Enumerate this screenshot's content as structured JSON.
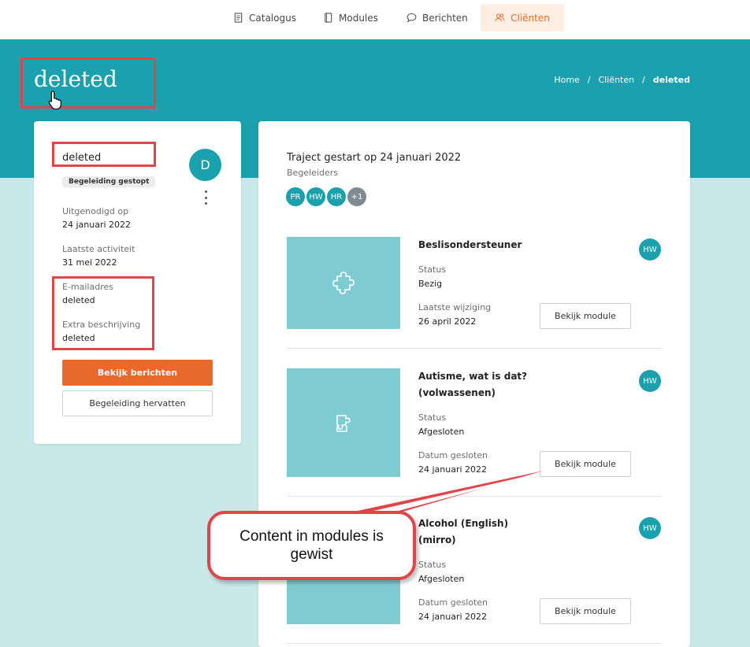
{
  "nav": {
    "items": [
      {
        "label": "Catalogus",
        "icon": "document-icon"
      },
      {
        "label": "Modules",
        "icon": "book-icon"
      },
      {
        "label": "Berichten",
        "icon": "chat-bubble-icon"
      },
      {
        "label": "Cliënten",
        "icon": "users-icon",
        "active": true
      }
    ]
  },
  "header": {
    "title": "deleted",
    "breadcrumb": [
      "Home",
      "Cliënten",
      "deleted"
    ],
    "separator": "/"
  },
  "profile": {
    "name": "deleted",
    "status": "Begeleiding gestopt",
    "avatar_initial": "D",
    "fields": [
      {
        "label": "Uitgenodigd op",
        "value": "24 januari 2022"
      },
      {
        "label": "Laatste activiteit",
        "value": "31 mei 2022"
      },
      {
        "label": "E-mailadres",
        "value": "deleted"
      },
      {
        "label": "Extra beschrijving",
        "value": "deleted"
      }
    ],
    "primary_button": "Bekijk berichten",
    "secondary_button": "Begeleiding hervatten"
  },
  "traject": {
    "title": "Traject gestart op 24 januari 2022",
    "subtitle": "Begeleiders",
    "begeleiders": [
      {
        "initials": "PR",
        "color": "#1ba0ad"
      },
      {
        "initials": "HW",
        "color": "#1ba0ad"
      },
      {
        "initials": "HR",
        "color": "#1ba0ad"
      },
      {
        "initials": "+1",
        "color": "#7f8a93"
      }
    ]
  },
  "modules": [
    {
      "title_lines": [
        "Beslisondersteuner"
      ],
      "status_label": "Status",
      "status": "Bezig",
      "date_label": "Laatste wijziging",
      "date": "26 april 2022",
      "owner": "HW",
      "button": "Bekijk module",
      "icon": "puzzle-icon"
    },
    {
      "title_lines": [
        "Autisme, wat is dat?",
        "(volwassenen)"
      ],
      "status_label": "Status",
      "status": "Afgesloten",
      "date_label": "Datum gesloten",
      "date": "24 januari 2022",
      "owner": "HW",
      "button": "Bekijk module",
      "icon": "puzzle-piece-icon"
    },
    {
      "title_lines": [
        "Alcohol (English)",
        "(mirro)"
      ],
      "status_label": "Status",
      "status": "Afgesloten",
      "date_label": "Datum gesloten",
      "date": "24 januari 2022",
      "owner": "HW",
      "button": "Bekijk module",
      "icon": "puzzle-icon"
    }
  ],
  "annotation": {
    "callout_text": "Content in modules is gewist",
    "highlight_color": "#e0454a"
  },
  "colors": {
    "teal": "#1ba0ad",
    "orange": "#e8692a",
    "light_teal": "#c9e8ea",
    "thumb": "#7ecbd2"
  }
}
